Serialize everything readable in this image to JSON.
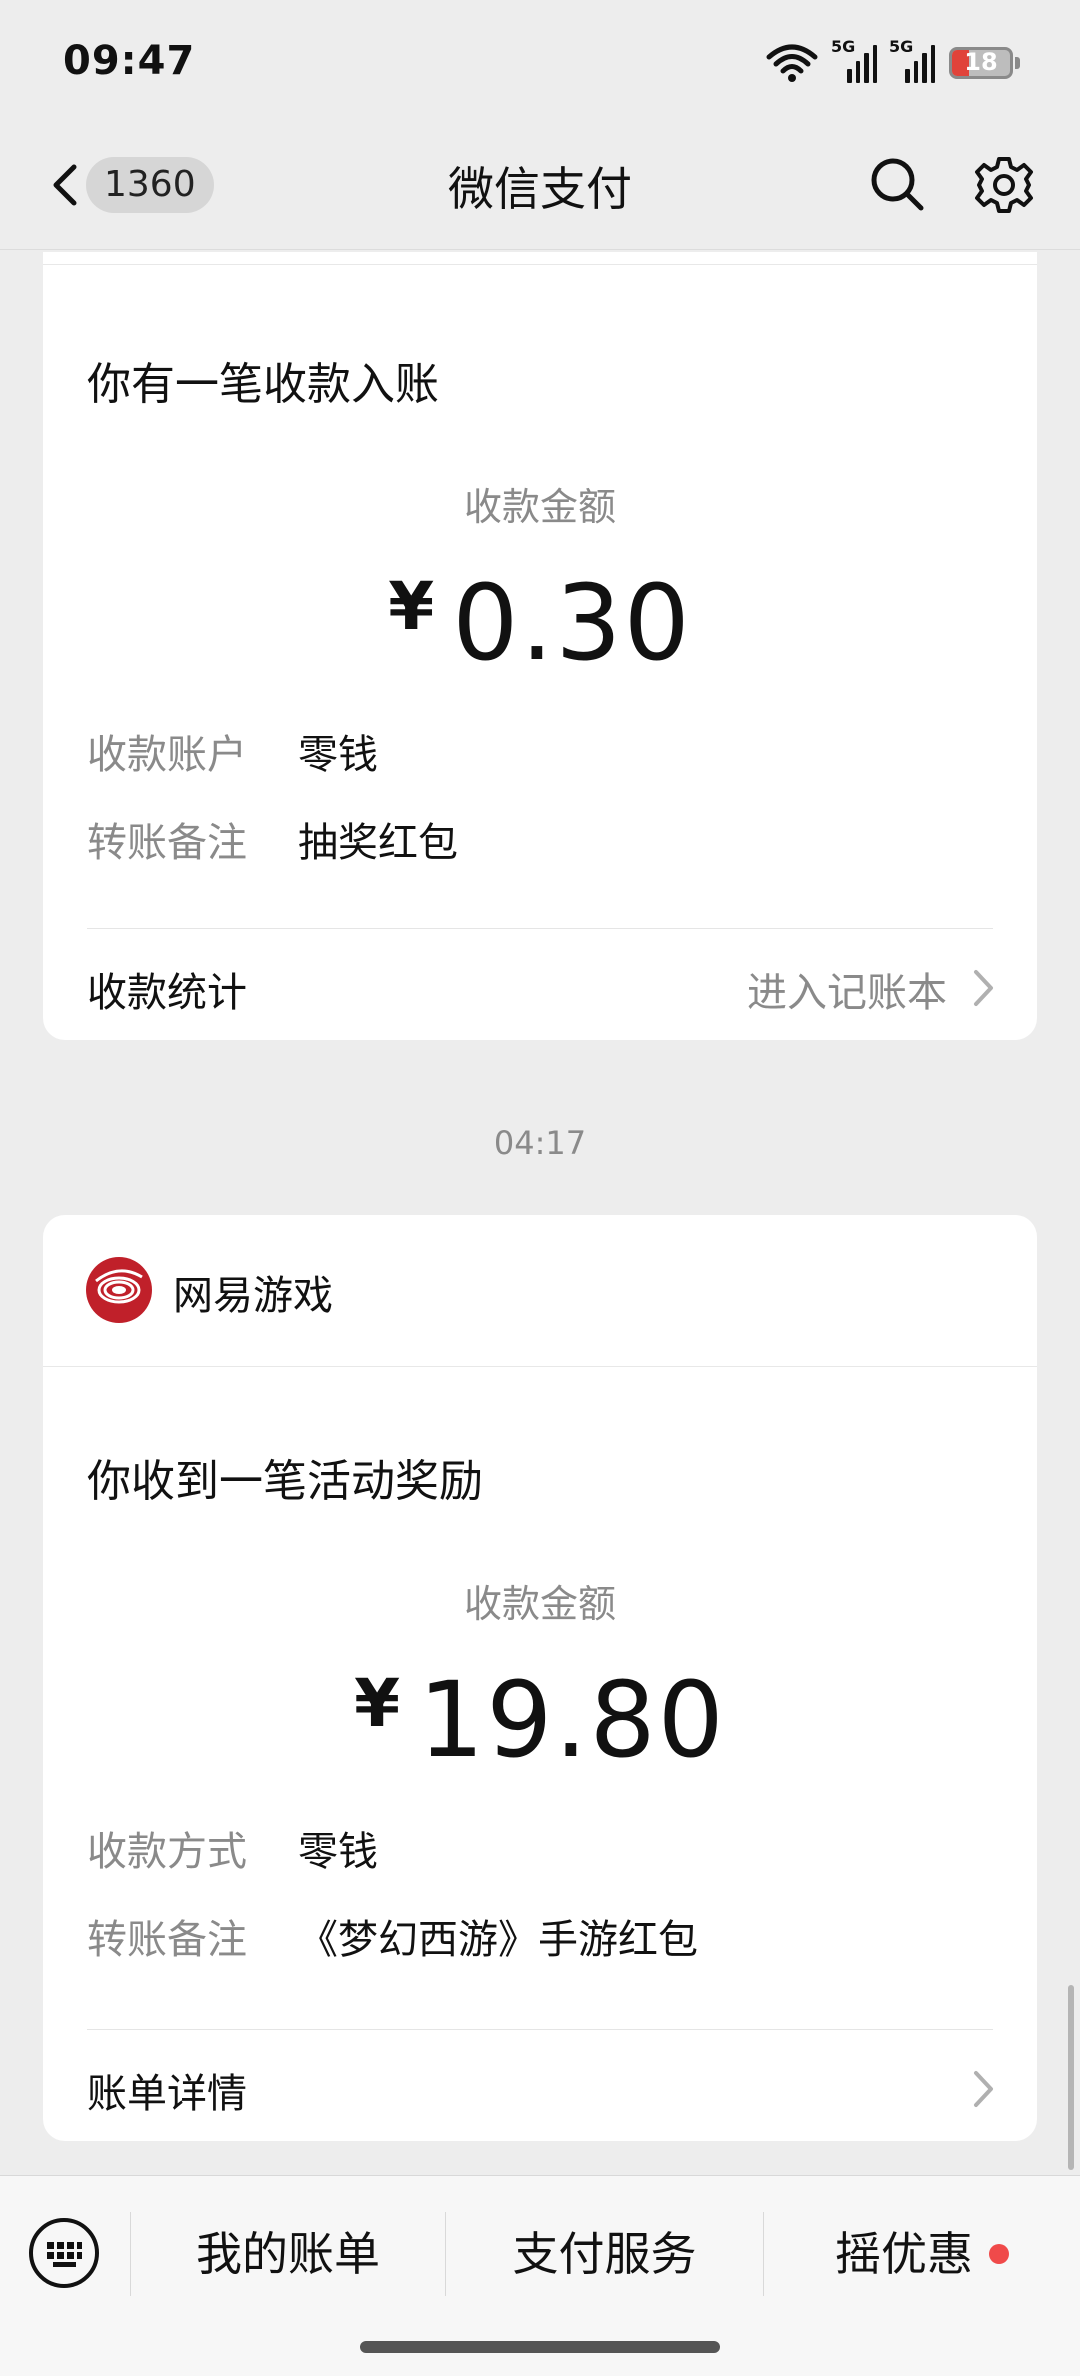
{
  "status_bar": {
    "time": "09:47",
    "network1": "5G",
    "network2": "5G",
    "battery": "18"
  },
  "nav": {
    "badge": "1360",
    "title": "微信支付"
  },
  "messages": [
    {
      "title": "你有一笔收款入账",
      "amount_label": "收款金额",
      "currency": "¥",
      "amount": "0.30",
      "rows": [
        {
          "key": "收款账户",
          "value": "零钱"
        },
        {
          "key": "转账备注",
          "value": "抽奖红包"
        }
      ],
      "footer_left": "收款统计",
      "footer_right": "进入记账本"
    },
    {
      "timestamp": "04:17",
      "merchant": "网易游戏",
      "title": "你收到一笔活动奖励",
      "amount_label": "收款金额",
      "currency": "¥",
      "amount": "19.80",
      "rows": [
        {
          "key": "收款方式",
          "value": "零钱"
        },
        {
          "key": "转账备注",
          "value": "《梦幻西游》手游红包"
        }
      ],
      "footer_left": "账单详情"
    }
  ],
  "bottom_menu": {
    "items": [
      "我的账单",
      "支付服务",
      "摇优惠"
    ]
  },
  "icons": {
    "back": "chevron-left-icon",
    "search": "search-icon",
    "settings": "gear-icon",
    "keyboard": "keyboard-icon",
    "chevron": "chevron-right-icon"
  },
  "colors": {
    "background": "#ededed",
    "card": "#ffffff",
    "muted_text": "#8a8a8a",
    "notification_dot": "#f04a4a",
    "merchant_logo": "#c0202a"
  }
}
